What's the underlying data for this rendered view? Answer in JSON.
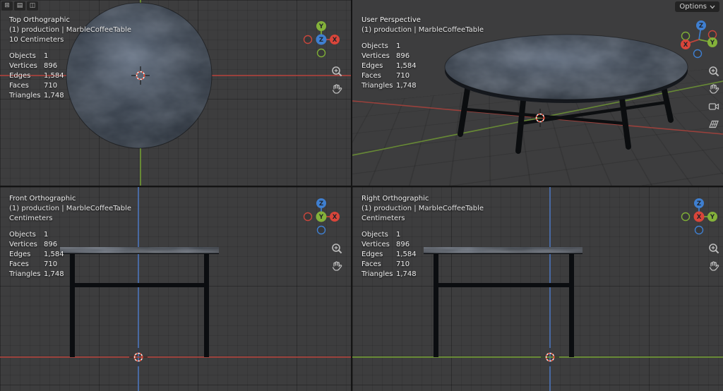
{
  "topbar": {
    "options_label": "Options",
    "editor_icon_glyphs": {
      "editor_type": "⊞",
      "shading": "▤",
      "overlays": "◫"
    }
  },
  "gizmo_labels": {
    "x": "X",
    "y": "Y",
    "z": "Z"
  },
  "stats_rows": [
    {
      "label": "Objects",
      "value": "1"
    },
    {
      "label": "Vertices",
      "value": "896"
    },
    {
      "label": "Edges",
      "value": "1,584"
    },
    {
      "label": "Faces",
      "value": "710"
    },
    {
      "label": "Triangles",
      "value": "1,748"
    }
  ],
  "viewports": {
    "top": {
      "title": "Top Orthographic",
      "scene": "(1) production | MarbleCoffeeTable",
      "grid_scale": "10 Centimeters"
    },
    "perspective": {
      "title": "User Perspective",
      "scene": "(1) production | MarbleCoffeeTable"
    },
    "front": {
      "title": "Front Orthographic",
      "scene": "(1) production | MarbleCoffeeTable",
      "grid_scale": "Centimeters"
    },
    "right": {
      "title": "Right Orthographic",
      "scene": "(1) production | MarbleCoffeeTable",
      "grid_scale": "Centimeters"
    }
  },
  "object_name": "MarbleCoffeeTable",
  "colors": {
    "axis_x": "#aa423c",
    "axis_y": "#6e9634",
    "axis_z": "#4a6fae",
    "gizmo_x": "#d9453a",
    "gizmo_y": "#84b23a",
    "gizmo_z": "#3f7fd0",
    "cursor": "#e8432c",
    "viewport_bg": "#3d3d3e"
  }
}
